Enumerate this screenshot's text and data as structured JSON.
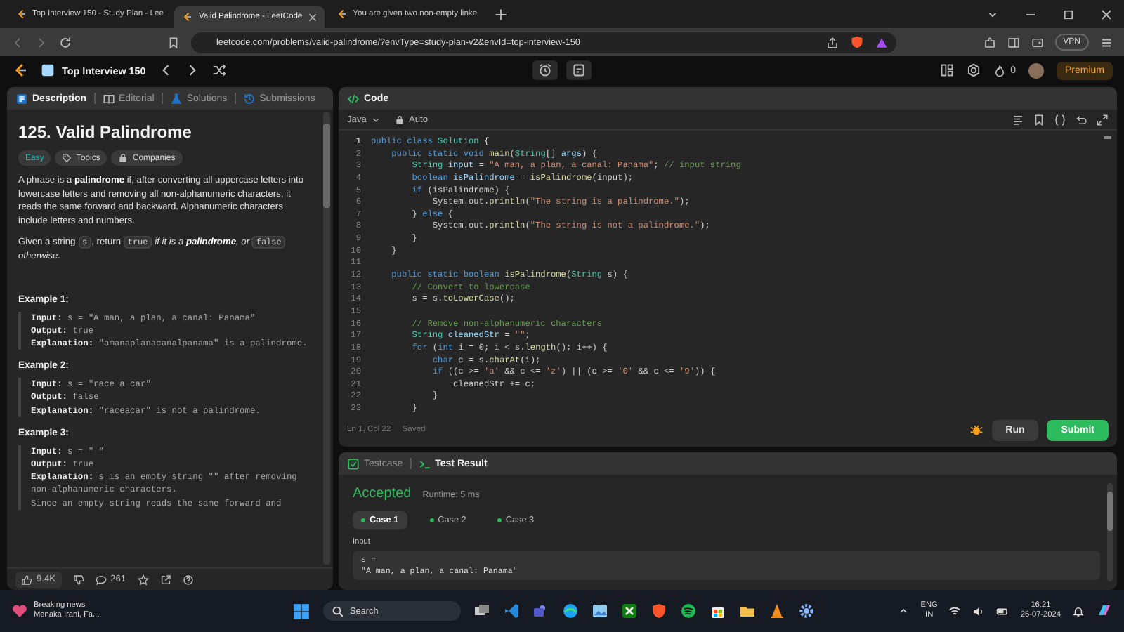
{
  "browser": {
    "tabs": [
      {
        "title": "Top Interview 150 - Study Plan - Lee",
        "selected": false
      },
      {
        "title": "Valid Palindrome - LeetCode",
        "selected": true
      },
      {
        "title": "You are given two non-empty linke",
        "selected": false
      }
    ],
    "url": "leetcode.com/problems/valid-palindrome/?envType=study-plan-v2&envId=top-interview-150",
    "vpn": "VPN"
  },
  "nav": {
    "title": "Top Interview 150",
    "streak": "0",
    "premium": "Premium"
  },
  "description": {
    "tabs": [
      {
        "label": "Description",
        "selected": true
      },
      {
        "label": "Editorial",
        "selected": false
      },
      {
        "label": "Solutions",
        "selected": false
      },
      {
        "label": "Submissions",
        "selected": false
      }
    ],
    "title": "125. Valid Palindrome",
    "difficulty": "Easy",
    "tags": [
      "Topics",
      "Companies"
    ],
    "paragraph": "A phrase is a **palindrome** if, after converting all uppercase letters into lowercase letters and removing all non-alphanumeric characters, it reads the same forward and backward. Alphanumeric characters include letters and numbers.",
    "statement": [
      {
        "kind": "text",
        "text": "Given a string "
      },
      {
        "kind": "code",
        "text": "s"
      },
      {
        "kind": "text",
        "text": ", return "
      },
      {
        "kind": "code",
        "text": "true"
      },
      {
        "kind": "italic",
        "text": " if it is a **palindrome**, or "
      },
      {
        "kind": "code",
        "text": "false"
      },
      {
        "kind": "italic",
        "text": " otherwise."
      }
    ],
    "examples": [
      {
        "title": "Example 1:",
        "lines": [
          {
            "label": "Input:",
            "value": "s = \"A man, a plan, a canal: Panama\""
          },
          {
            "label": "Output:",
            "value": "true"
          },
          {
            "label": "Explanation:",
            "value": "\"amanaplanacanalpanama\" is a palindrome."
          }
        ]
      },
      {
        "title": "Example 2:",
        "lines": [
          {
            "label": "Input:",
            "value": "s = \"race a car\""
          },
          {
            "label": "Output:",
            "value": "false"
          },
          {
            "label": "Explanation:",
            "value": "\"raceacar\" is not a palindrome."
          }
        ]
      },
      {
        "title": "Example 3:",
        "lines": [
          {
            "label": "Input:",
            "value": "s = \" \""
          },
          {
            "label": "Output:",
            "value": "true"
          },
          {
            "label": "Explanation:",
            "value": "s is an empty string \"\" after removing non-alphanumeric characters.\nSince an empty string reads the same forward and"
          }
        ]
      }
    ],
    "likes": "9.4K",
    "comments": "261"
  },
  "editor": {
    "title": "Code",
    "language": "Java",
    "mode": "Auto",
    "lines": [
      {
        "number": "1",
        "tokens": [
          {
            "kind": "keyword",
            "text": "public class "
          },
          {
            "kind": "type",
            "text": "Solution"
          },
          {
            "kind": "plain",
            "text": " {"
          }
        ]
      },
      {
        "number": "2",
        "tokens": [
          {
            "kind": "keyword",
            "text": "    public static void "
          },
          {
            "kind": "function",
            "text": "main"
          },
          {
            "kind": "plain",
            "text": "("
          },
          {
            "kind": "type",
            "text": "String"
          },
          {
            "kind": "plain",
            "text": "[] "
          },
          {
            "kind": "variable",
            "text": "args"
          },
          {
            "kind": "plain",
            "text": ") {"
          }
        ]
      },
      {
        "number": "3",
        "tokens": [
          {
            "kind": "type",
            "text": "        String"
          },
          {
            "kind": "variable",
            "text": " input"
          },
          {
            "kind": "plain",
            "text": " = "
          },
          {
            "kind": "string",
            "text": "\"A man, a plan, a canal: Panama\""
          },
          {
            "kind": "plain",
            "text": "; "
          },
          {
            "kind": "comment",
            "text": "// input string"
          }
        ]
      },
      {
        "number": "4",
        "tokens": [
          {
            "kind": "keyword",
            "text": "        boolean "
          },
          {
            "kind": "variable",
            "text": "isPalindrome"
          },
          {
            "kind": "plain",
            "text": " = "
          },
          {
            "kind": "function",
            "text": "isPalindrome"
          },
          {
            "kind": "plain",
            "text": "(input);"
          }
        ]
      },
      {
        "number": "5",
        "tokens": [
          {
            "kind": "keyword",
            "text": "        if"
          },
          {
            "kind": "plain",
            "text": " (isPalindrome) {"
          }
        ]
      },
      {
        "number": "6",
        "tokens": [
          {
            "kind": "plain",
            "text": "            System.out."
          },
          {
            "kind": "function",
            "text": "println"
          },
          {
            "kind": "plain",
            "text": "("
          },
          {
            "kind": "string",
            "text": "\"The string is a palindrome.\""
          },
          {
            "kind": "plain",
            "text": ");"
          }
        ]
      },
      {
        "number": "7",
        "tokens": [
          {
            "kind": "plain",
            "text": "        } "
          },
          {
            "kind": "keyword",
            "text": "else"
          },
          {
            "kind": "plain",
            "text": " {"
          }
        ]
      },
      {
        "number": "8",
        "tokens": [
          {
            "kind": "plain",
            "text": "            System.out."
          },
          {
            "kind": "function",
            "text": "println"
          },
          {
            "kind": "plain",
            "text": "("
          },
          {
            "kind": "string",
            "text": "\"The string is not a palindrome.\""
          },
          {
            "kind": "plain",
            "text": ");"
          }
        ]
      },
      {
        "number": "9",
        "tokens": [
          {
            "kind": "plain",
            "text": "        }"
          }
        ]
      },
      {
        "number": "10",
        "tokens": [
          {
            "kind": "plain",
            "text": "    }"
          }
        ]
      },
      {
        "number": "11"
      },
      {
        "number": "12",
        "tokens": [
          {
            "kind": "keyword",
            "text": "    public static boolean "
          },
          {
            "kind": "function",
            "text": "isPalindrome"
          },
          {
            "kind": "plain",
            "text": "("
          },
          {
            "kind": "type",
            "text": "String"
          },
          {
            "kind": "plain",
            "text": " s) {"
          }
        ]
      },
      {
        "number": "13",
        "tokens": [
          {
            "kind": "comment",
            "text": "        // Convert to lowercase"
          }
        ]
      },
      {
        "number": "14",
        "tokens": [
          {
            "kind": "plain",
            "text": "        s = s."
          },
          {
            "kind": "function",
            "text": "toLowerCase"
          },
          {
            "kind": "plain",
            "text": "();"
          }
        ]
      },
      {
        "number": "15"
      },
      {
        "number": "16",
        "tokens": [
          {
            "kind": "comment",
            "text": "        // Remove non-alphanumeric characters"
          }
        ]
      },
      {
        "number": "17",
        "tokens": [
          {
            "kind": "type",
            "text": "        String"
          },
          {
            "kind": "variable",
            "text": " cleanedStr"
          },
          {
            "kind": "plain",
            "text": " = "
          },
          {
            "kind": "string",
            "text": "\"\""
          },
          {
            "kind": "plain",
            "text": ";"
          }
        ]
      },
      {
        "number": "18",
        "tokens": [
          {
            "kind": "keyword",
            "text": "        for"
          },
          {
            "kind": "plain",
            "text": " ("
          },
          {
            "kind": "keyword",
            "text": "int"
          },
          {
            "kind": "plain",
            "text": " i = 0; i < s."
          },
          {
            "kind": "function",
            "text": "length"
          },
          {
            "kind": "plain",
            "text": "(); i++) {"
          }
        ]
      },
      {
        "number": "19",
        "tokens": [
          {
            "kind": "keyword",
            "text": "            char"
          },
          {
            "kind": "plain",
            "text": " c = s."
          },
          {
            "kind": "function",
            "text": "charAt"
          },
          {
            "kind": "plain",
            "text": "(i);"
          }
        ]
      },
      {
        "number": "20",
        "tokens": [
          {
            "kind": "keyword",
            "text": "            if"
          },
          {
            "kind": "plain",
            "text": " ((c >= "
          },
          {
            "kind": "string",
            "text": "'a'"
          },
          {
            "kind": "plain",
            "text": " && c <= "
          },
          {
            "kind": "string",
            "text": "'z'"
          },
          {
            "kind": "plain",
            "text": ") || (c >= "
          },
          {
            "kind": "string",
            "text": "'0'"
          },
          {
            "kind": "plain",
            "text": " && c <= "
          },
          {
            "kind": "string",
            "text": "'9'"
          },
          {
            "kind": "plain",
            "text": ")) {"
          }
        ]
      },
      {
        "number": "21",
        "tokens": [
          {
            "kind": "plain",
            "text": "                cleanedStr += c;"
          }
        ]
      },
      {
        "number": "22",
        "tokens": [
          {
            "kind": "plain",
            "text": "            }"
          }
        ]
      },
      {
        "number": "23",
        "tokens": [
          {
            "kind": "plain",
            "text": "        }"
          }
        ]
      }
    ],
    "status": "Ln 1, Col 22",
    "saved": "Saved",
    "run": "Run",
    "submit": "Submit"
  },
  "result": {
    "tabs": [
      {
        "label": "Testcase",
        "selected": false
      },
      {
        "label": "Test Result",
        "selected": true
      }
    ],
    "verdict": "Accepted",
    "runtime": "Runtime: 5 ms",
    "cases": [
      {
        "label": "Case 1",
        "selected": true,
        "passed": true
      },
      {
        "label": "Case 2",
        "selected": false,
        "passed": true
      },
      {
        "label": "Case 3",
        "selected": false,
        "passed": true
      }
    ],
    "input_label": "Input",
    "input_name": "s =",
    "input_value": "\"A man, a plan, a canal: Panama\""
  },
  "taskbar": {
    "news_title": "Breaking news",
    "news_text": "Menaka Irani, Fa...",
    "search": "Search",
    "language": "ENG",
    "region": "IN",
    "time": "16:21",
    "date": "26-07-2024"
  }
}
